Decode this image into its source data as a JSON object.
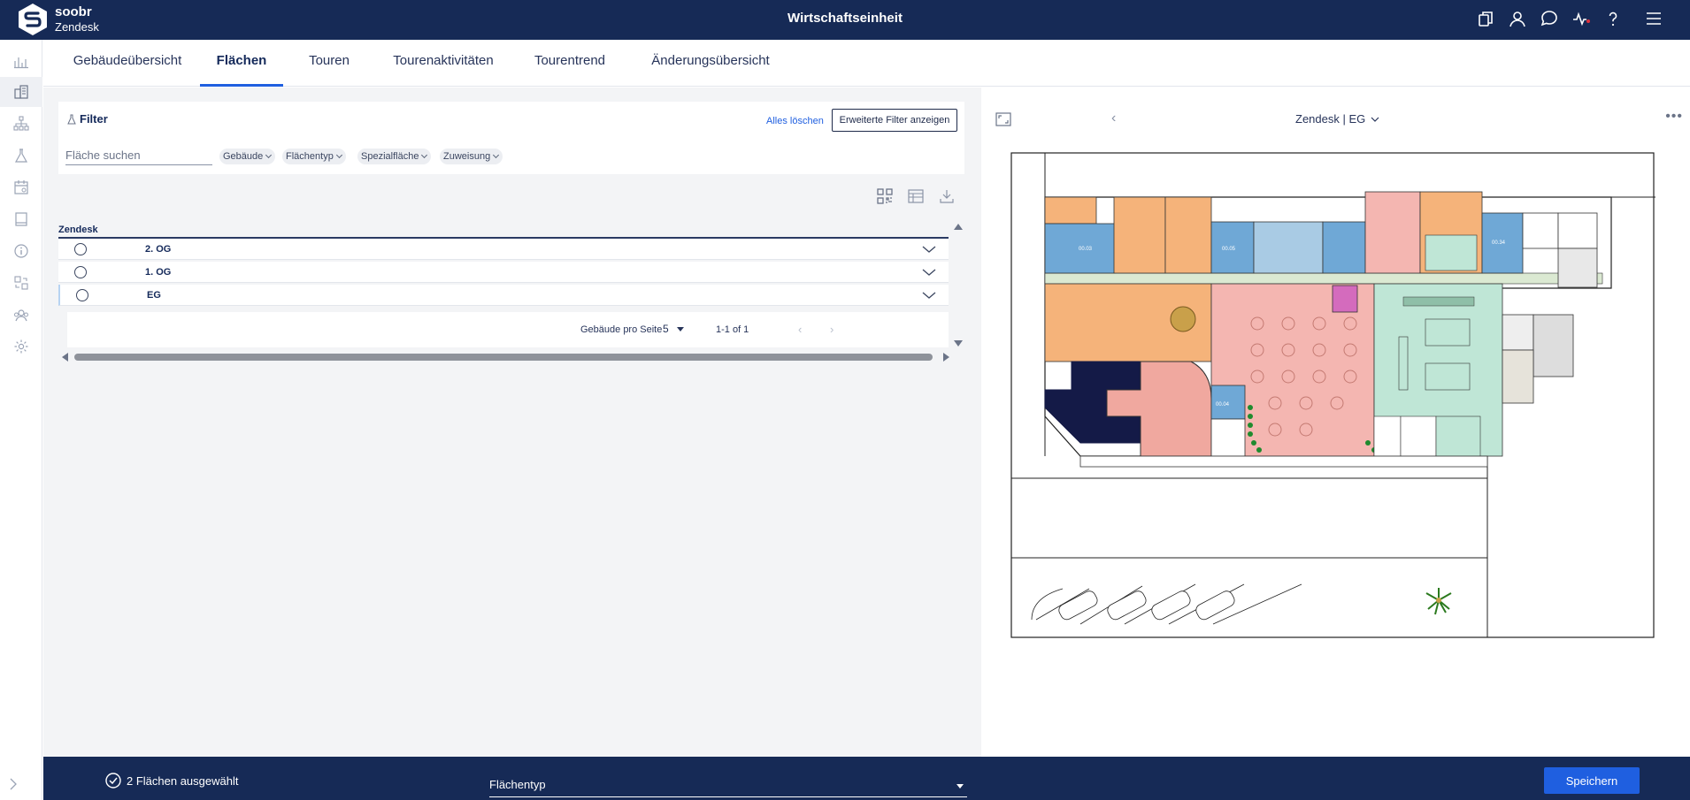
{
  "header": {
    "brand_name": "soobr",
    "brand_sub": "Zendesk",
    "title": "Wirtschaftseinheit",
    "icons": [
      "copy-icon",
      "user-icon",
      "chat-icon",
      "activity-icon",
      "help-icon",
      "menu-icon"
    ]
  },
  "rail": {
    "icons": [
      "bar-chart-icon",
      "building-icon",
      "hierarchy-icon",
      "flask-icon",
      "calendar-icon",
      "tablet-icon",
      "info-icon",
      "swap-icon",
      "people-icon",
      "gear-icon"
    ],
    "active_index": 1
  },
  "tabs": [
    {
      "label": "Gebäudeübersicht"
    },
    {
      "label": "Flächen"
    },
    {
      "label": "Touren"
    },
    {
      "label": "Tourenaktivitäten"
    },
    {
      "label": "Tourentrend"
    },
    {
      "label": "Änderungsübersicht"
    }
  ],
  "active_tab": "Flächen",
  "filter": {
    "title": "Filter",
    "clear_all": "Alles löschen",
    "advanced": "Erweiterte Filter anzeigen",
    "search_placeholder": "Fläche suchen",
    "chips": [
      "Gebäude",
      "Flächentyp",
      "Spezialfläche",
      "Zuweisung"
    ]
  },
  "table": {
    "group": "Zendesk",
    "rows": [
      {
        "label": "2. OG"
      },
      {
        "label": "1. OG"
      },
      {
        "label": "EG"
      }
    ],
    "pager": {
      "per_page_label": "Gebäude pro Seite",
      "per_page_value": "5",
      "range": "1-1 of 1"
    }
  },
  "plan": {
    "title": "Zendesk | EG",
    "room_labels": [
      "00.03",
      "00.05",
      "00.04",
      "00.34"
    ]
  },
  "bottom": {
    "selected_text": "2 Flächen ausgewählt",
    "type_select_value": "Flächentyp",
    "save_label": "Speichern"
  },
  "colors": {
    "header_bg": "#162a56",
    "accent": "#1f5fe0",
    "office": "#f5b37a",
    "meeting": "#6fa8d6",
    "dining": "#f4b6b1",
    "kitchen": "#bfe6d6",
    "dark_zone": "#141a47",
    "restroom": "#d46bbd"
  }
}
